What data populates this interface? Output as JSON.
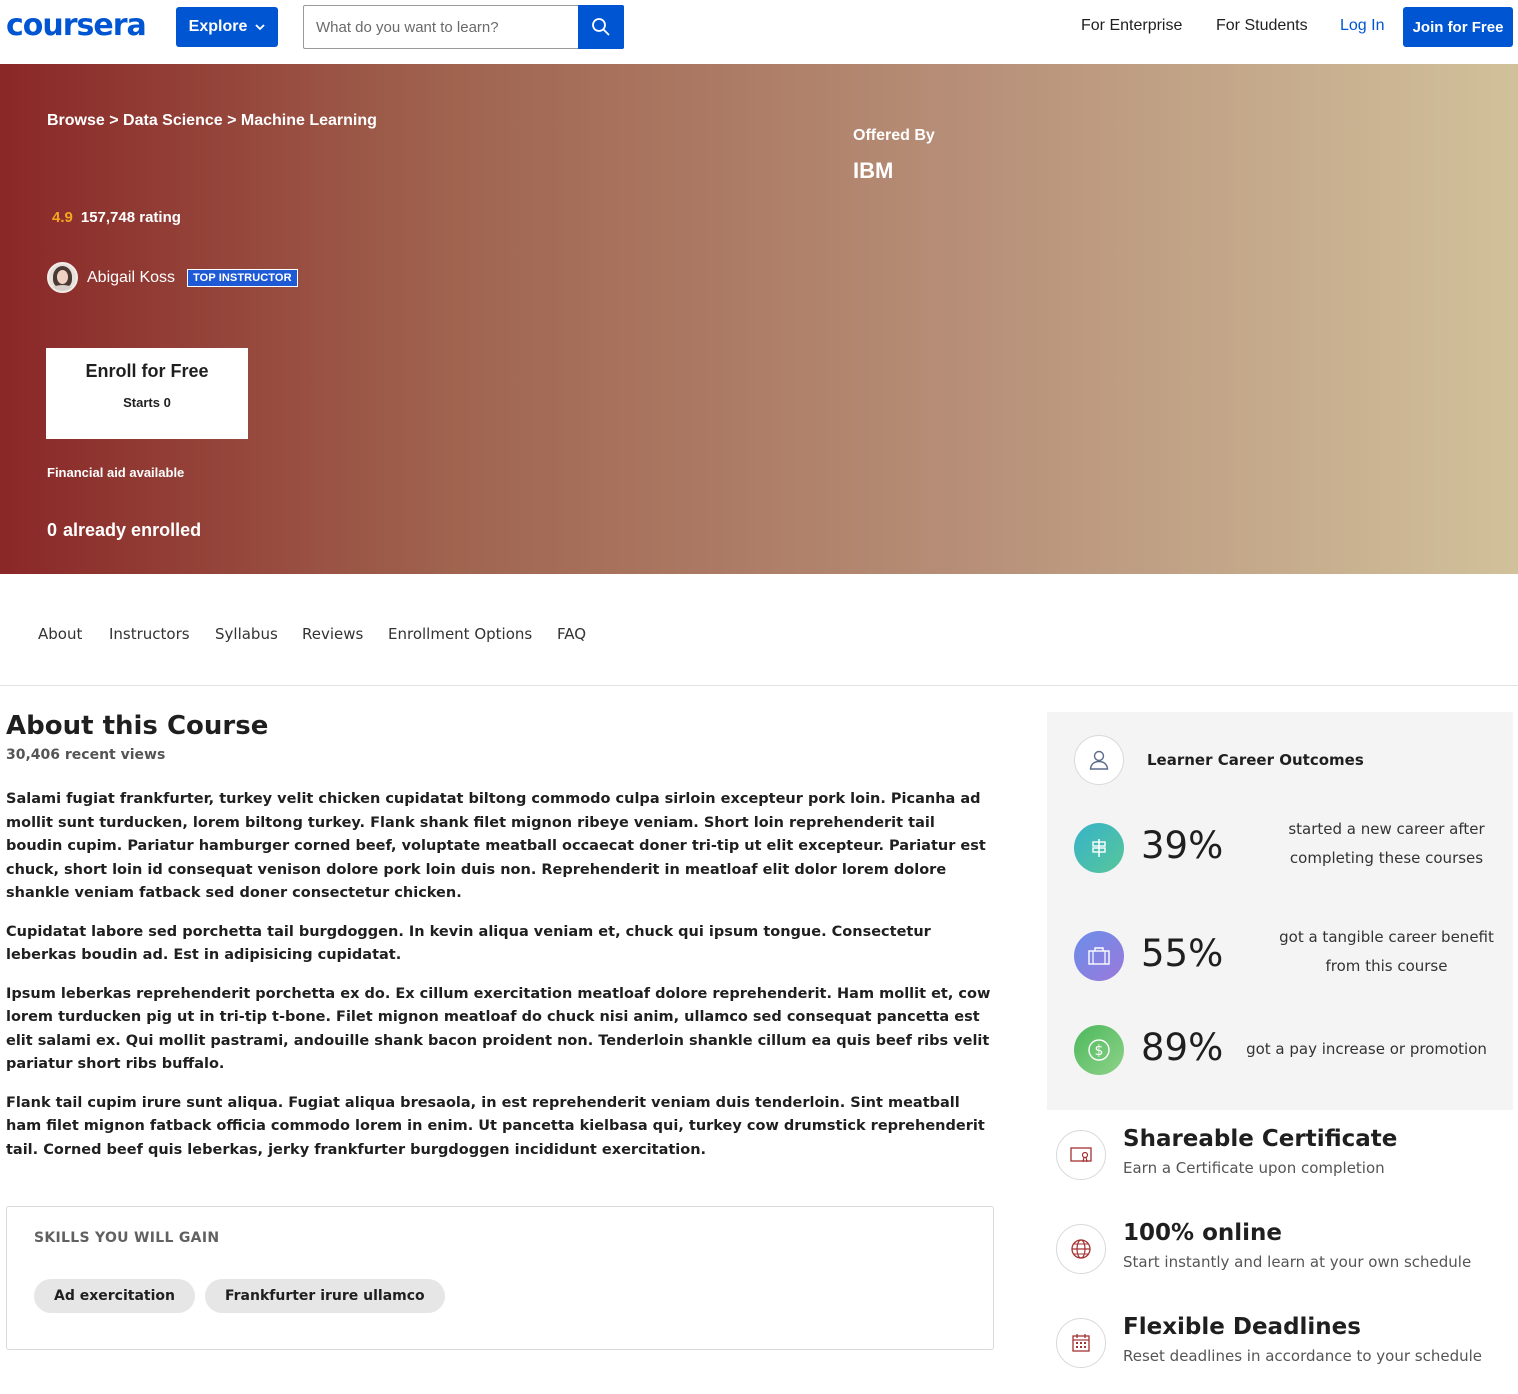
{
  "header": {
    "logo": "coursera",
    "explore_label": "Explore",
    "search_placeholder": "What do you want to learn?",
    "nav": {
      "enterprise": "For Enterprise",
      "students": "For Students",
      "login": "Log In"
    },
    "join_label": "Join for Free",
    "brand_color": "#0056d2"
  },
  "hero": {
    "breadcrumb": "Browse > Data Science > Machine Learning",
    "offered_by_label": "Offered By",
    "partner": "IBM",
    "rating": "4.9",
    "rating_count": "157,748 rating",
    "instructor_name": "Abigail Koss",
    "instructor_badge": "TOP INSTRUCTOR",
    "enroll_label": "Enroll for Free",
    "enroll_sub": "Starts 0",
    "financial_aid": "Financial aid available",
    "enrolled_count": "0",
    "enrolled_label": "already enrolled",
    "gradient": [
      "#8a2727",
      "#d1c19b"
    ]
  },
  "tabs": [
    "About",
    "Instructors",
    "Syllabus",
    "Reviews",
    "Enrollment Options",
    "FAQ"
  ],
  "about": {
    "title": "About this Course",
    "views": "30,406 recent views",
    "paragraphs": [
      "Salami fugiat frankfurter, turkey velit chicken cupidatat biltong commodo culpa sirloin excepteur pork loin. Picanha ad mollit sunt turducken, lorem biltong turkey. Flank shank filet mignon ribeye veniam. Short loin reprehenderit tail boudin cupim. Pariatur hamburger corned beef, voluptate meatball occaecat doner tri-tip ut elit excepteur. Pariatur est chuck, short loin id consequat venison dolore pork loin duis non. Reprehenderit in meatloaf elit dolor lorem dolore shankle veniam fatback sed doner consectetur chicken.",
      "Cupidatat labore sed porchetta tail burgdoggen. In kevin aliqua veniam et, chuck qui ipsum tongue. Consectetur leberkas boudin ad. Est in adipisicing cupidatat.",
      "Ipsum leberkas reprehenderit porchetta ex do. Ex cillum exercitation meatloaf dolore reprehenderit. Ham mollit et, cow lorem turducken pig ut in tri-tip t-bone. Filet mignon meatloaf do chuck nisi anim, ullamco sed consequat pancetta est elit salami ex. Qui mollit pastrami, andouille shank bacon proident non. Tenderloin shankle cillum ea quis beef ribs velit pariatur short ribs buffalo.",
      "Flank tail cupim irure sunt aliqua. Fugiat aliqua bresaola, in est reprehenderit veniam duis tenderloin. Sint meatball ham filet mignon fatback officia commodo lorem in enim. Ut pancetta kielbasa qui, turkey cow drumstick reprehenderit tail. Corned beef quis leberkas, jerky frankfurter burgdoggen incididunt exercitation."
    ]
  },
  "skills": {
    "title": "SKILLS YOU WILL GAIN",
    "items": [
      "Ad exercitation",
      "Frankfurter irure ullamco"
    ]
  },
  "outcomes": {
    "title": "Learner Career Outcomes",
    "items": [
      {
        "pct": "39%",
        "line1": "started a new career after",
        "line2": "completing these courses",
        "icon": "signpost-icon",
        "color": "#3fb8b0"
      },
      {
        "pct": "55%",
        "line1": "got a tangible career benefit",
        "line2": "from this course",
        "icon": "briefcase-icon",
        "color": "#7e7fe0"
      },
      {
        "pct": "89%",
        "line1": "got a pay increase or promotion",
        "line2": "",
        "icon": "dollar-icon",
        "color": "#5cc384"
      }
    ]
  },
  "features": [
    {
      "title": "Shareable Certificate",
      "sub": "Earn a Certificate upon completion",
      "icon": "certificate-icon"
    },
    {
      "title": "100% online",
      "sub": "Start instantly and learn at your own schedule",
      "icon": "globe-icon"
    },
    {
      "title": "Flexible Deadlines",
      "sub": "Reset deadlines in accordance to your schedule",
      "icon": "calendar-icon"
    }
  ]
}
